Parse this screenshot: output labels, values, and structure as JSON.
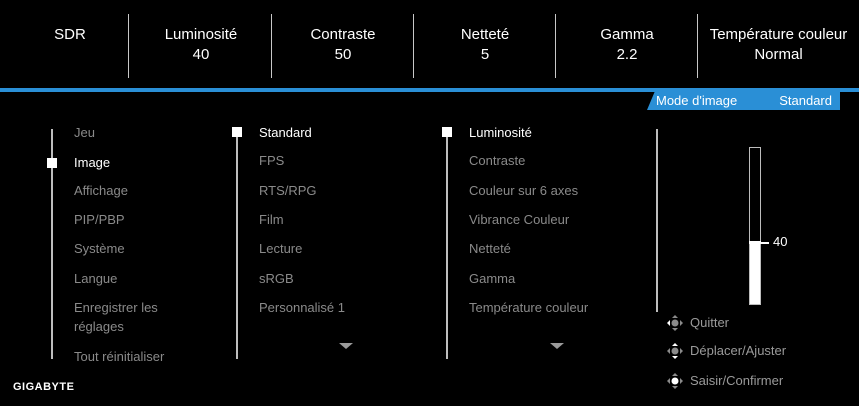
{
  "status_bar": [
    {
      "label": "SDR",
      "value": ""
    },
    {
      "label": "Luminosité",
      "value": "40"
    },
    {
      "label": "Contraste",
      "value": "50"
    },
    {
      "label": "Netteté",
      "value": "5"
    },
    {
      "label": "Gamma",
      "value": "2.2"
    },
    {
      "label": "Température couleur",
      "value": "Normal"
    }
  ],
  "mode_tab": {
    "label": "Mode d'image",
    "value": "Standard"
  },
  "main_menu": {
    "items": [
      "Jeu",
      "Image",
      "Affichage",
      "PIP/PBP",
      "Système",
      "Langue",
      "Enregistrer les",
      "réglages",
      "Tout réinitialiser"
    ],
    "selected": "Image"
  },
  "picture_modes": {
    "items": [
      "Standard",
      "FPS",
      "RTS/RPG",
      "Film",
      "Lecture",
      "sRGB",
      "Personnalisé 1"
    ],
    "selected": "Standard"
  },
  "settings": {
    "items": [
      "Luminosité",
      "Contraste",
      "Couleur sur 6 axes",
      "Vibrance Couleur",
      "Netteté",
      "Gamma",
      "Température couleur"
    ],
    "selected": "Luminosité"
  },
  "slider": {
    "value": "40",
    "level": 0.4
  },
  "hints": {
    "quit": "Quitter",
    "move": "Déplacer/Ajuster",
    "enter": "Saisir/Confirmer"
  },
  "brand": "GIGABYTE",
  "colors": {
    "accent": "#2a8fd6",
    "active_text": "#ffffff",
    "inactive_text": "#8a8a8a"
  }
}
